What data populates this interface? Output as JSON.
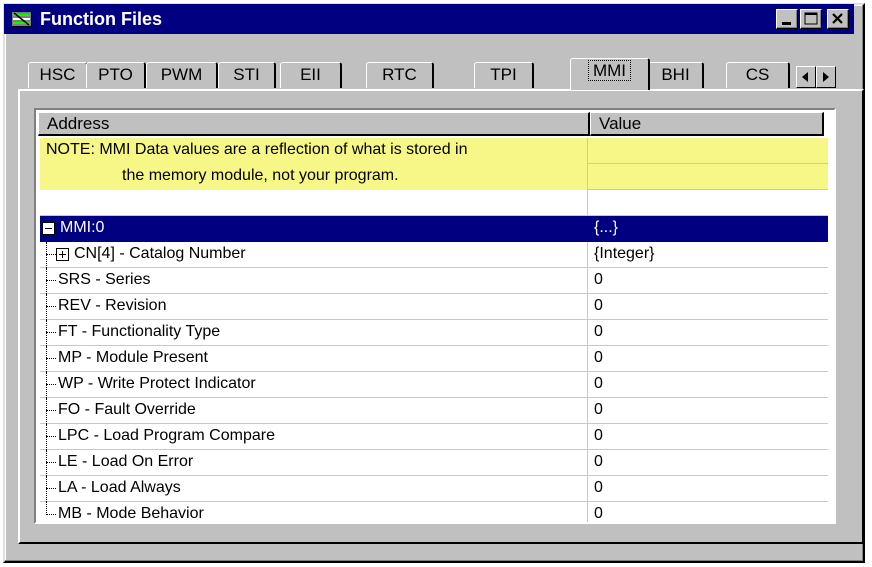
{
  "window": {
    "title": "Function Files"
  },
  "tabs": [
    "HSC",
    "PTO",
    "PWM",
    "STI",
    "EII",
    "RTC",
    "TPI",
    "MMI",
    "BHI",
    "CS"
  ],
  "active_tab": "MMI",
  "columns": {
    "address": "Address",
    "value": "Value"
  },
  "note": {
    "line1": "NOTE: MMI Data values are a reflection of what is stored in",
    "line2": "the memory module, not your program."
  },
  "root": {
    "label": "MMI:0",
    "value": "{...}"
  },
  "rows": [
    {
      "label": "CN[4] - Catalog Number",
      "value": "{Integer}",
      "expandable": true
    },
    {
      "label": "SRS - Series",
      "value": "0"
    },
    {
      "label": "REV - Revision",
      "value": "0"
    },
    {
      "label": "FT - Functionality Type",
      "value": "0"
    },
    {
      "label": "MP - Module Present",
      "value": "0"
    },
    {
      "label": "WP - Write Protect Indicator",
      "value": "0"
    },
    {
      "label": "FO - Fault Override",
      "value": "0"
    },
    {
      "label": "LPC - Load Program Compare",
      "value": "0"
    },
    {
      "label": "LE - Load On Error",
      "value": "0"
    },
    {
      "label": "LA - Load Always",
      "value": "0"
    },
    {
      "label": "MB - Mode Behavior",
      "value": "0"
    }
  ],
  "icons": {
    "app": "function-files-icon",
    "minimize": "minimize-icon",
    "maximize": "maximize-icon",
    "close": "close-icon",
    "tab_left": "arrow-left-icon",
    "tab_right": "arrow-right-icon",
    "collapse": "minus-box-icon",
    "expand": "plus-box-icon"
  },
  "colors": {
    "titlebar": "#000080",
    "selection": "#000080",
    "note_bg": "#f7f787",
    "face": "#c0c0c0"
  }
}
